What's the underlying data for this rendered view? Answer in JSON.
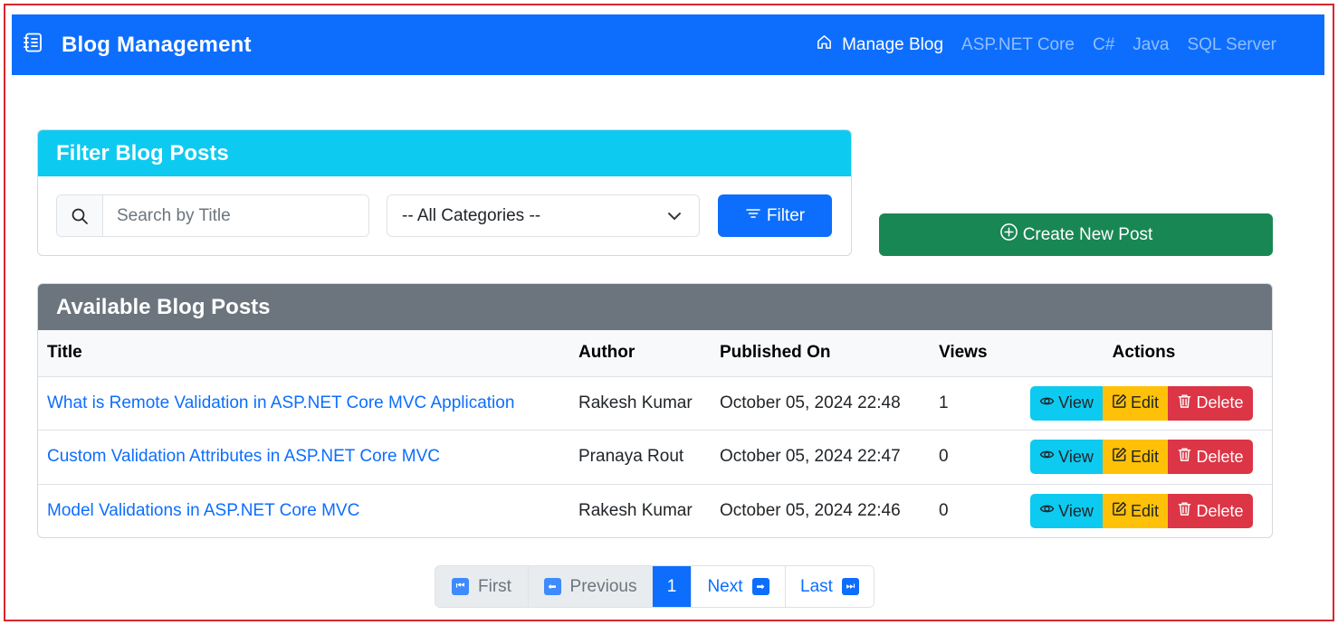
{
  "navbar": {
    "brand_title": "Blog Management",
    "links": [
      {
        "label": "Manage Blog",
        "active": true
      },
      {
        "label": "ASP.NET Core",
        "active": false
      },
      {
        "label": "C#",
        "active": false
      },
      {
        "label": "Java",
        "active": false
      },
      {
        "label": "SQL Server",
        "active": false
      }
    ]
  },
  "filter": {
    "header": "Filter Blog Posts",
    "search_placeholder": "Search by Title",
    "search_value": "",
    "category_selected": "-- All Categories --",
    "filter_button": "Filter"
  },
  "create_button": "Create New Post",
  "posts": {
    "header": "Available Blog Posts",
    "columns": [
      "Title",
      "Author",
      "Published On",
      "Views",
      "Actions"
    ],
    "rows": [
      {
        "title": "What is Remote Validation in ASP.NET Core MVC Application",
        "author": "Rakesh Kumar",
        "published": "October 05, 2024 22:48",
        "views": "1"
      },
      {
        "title": "Custom Validation Attributes in ASP.NET Core MVC",
        "author": "Pranaya Rout",
        "published": "October 05, 2024 22:47",
        "views": "0"
      },
      {
        "title": "Model Validations in ASP.NET Core MVC",
        "author": "Rakesh Kumar",
        "published": "October 05, 2024 22:46",
        "views": "0"
      }
    ],
    "actions": {
      "view": "View",
      "edit": "Edit",
      "delete": "Delete"
    }
  },
  "pagination": {
    "first": "First",
    "previous": "Previous",
    "current_page": "1",
    "next": "Next",
    "last": "Last"
  },
  "colors": {
    "primary": "#0d6efd",
    "info": "#0dcaf0",
    "success": "#198754",
    "secondary": "#6c757d",
    "warning": "#ffc107",
    "danger": "#dc3545",
    "frame": "#d9262f"
  }
}
